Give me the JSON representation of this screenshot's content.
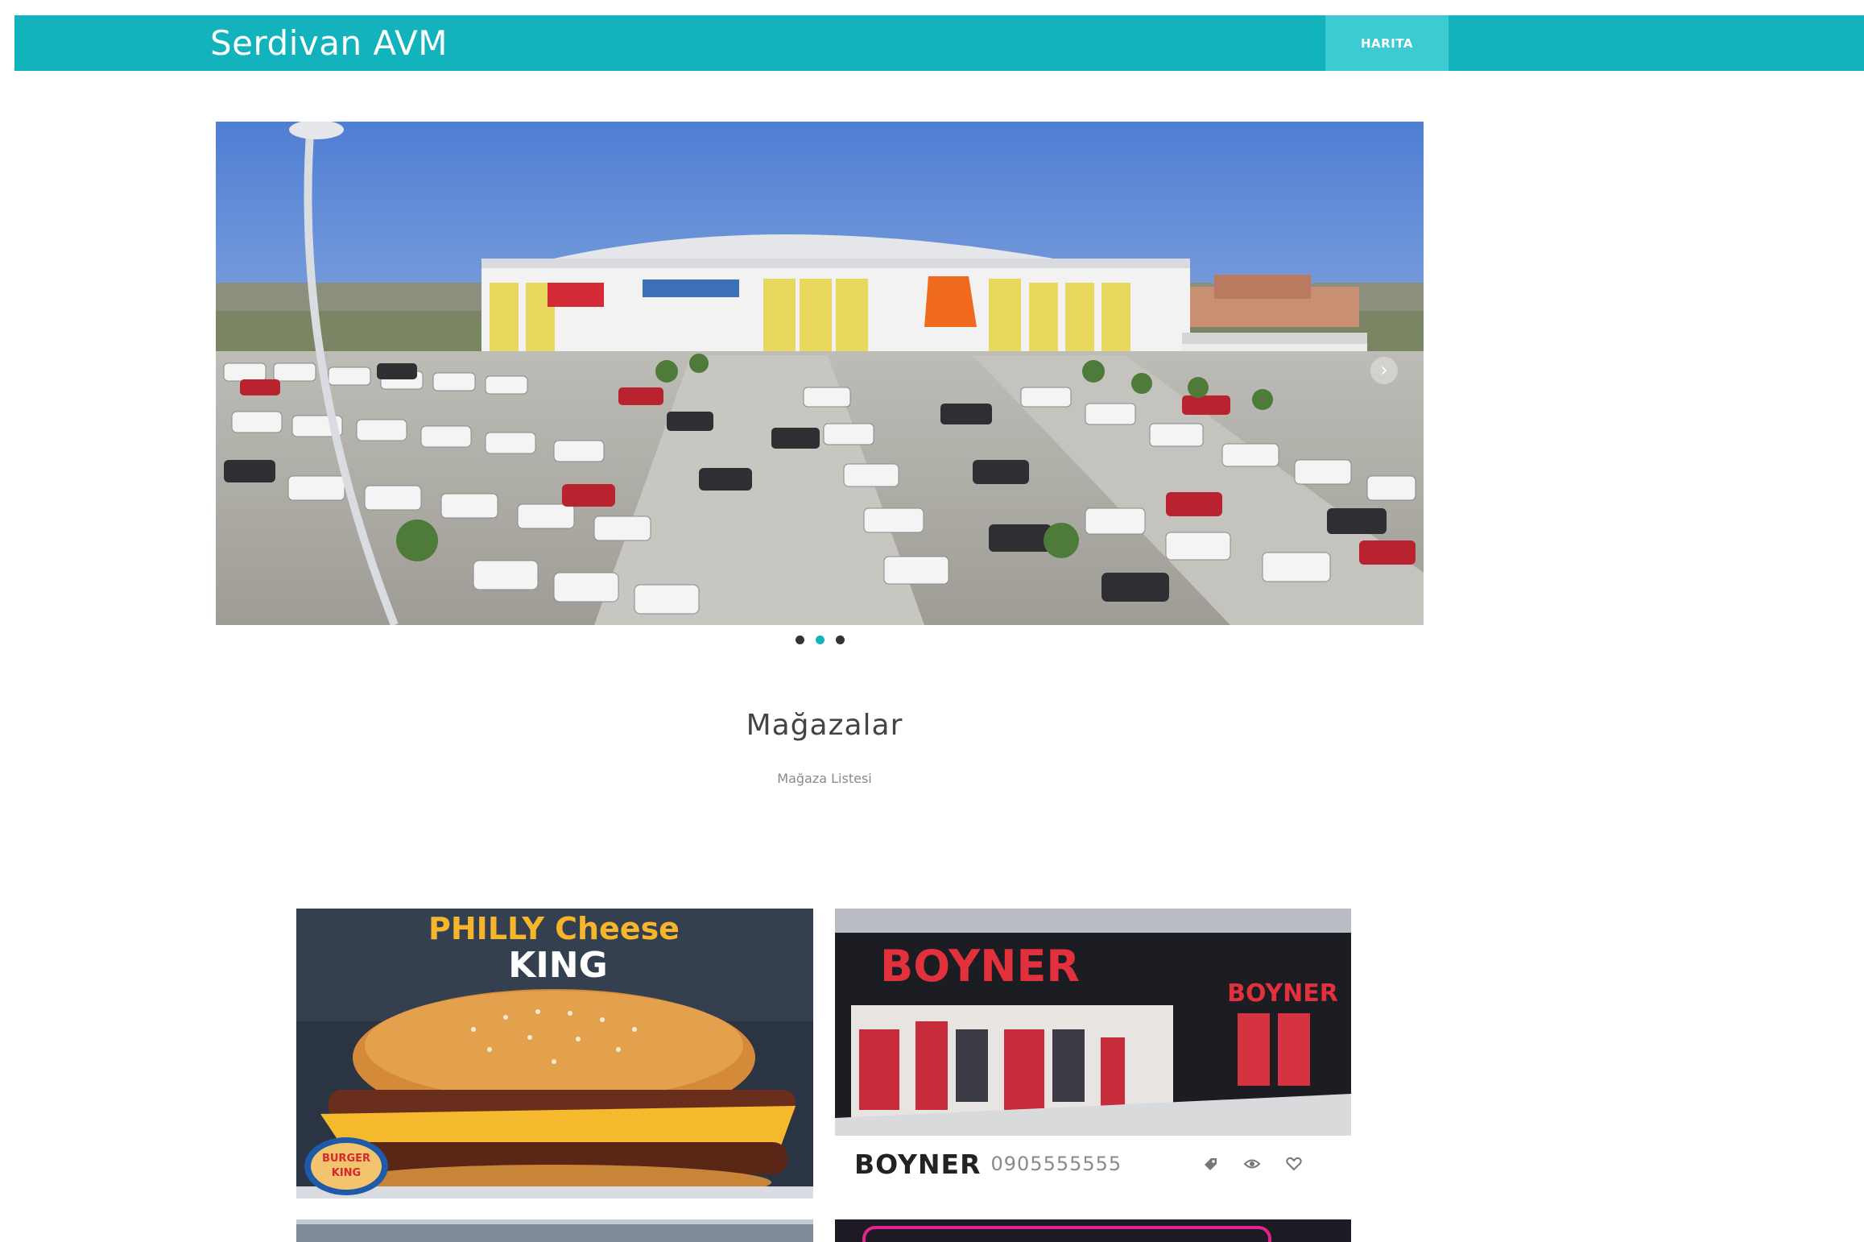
{
  "header": {
    "brand": "Serdivan AVM",
    "nav": [
      {
        "label": "HARITA"
      }
    ]
  },
  "carousel": {
    "slide_count": 3,
    "active_index": 1,
    "next_icon": "chevron-right-icon"
  },
  "section": {
    "title": "Mağazalar",
    "subtitle": "Mağaza Listesi"
  },
  "stores": [
    {
      "image_text": {
        "line1": "PHILLY Cheese",
        "line2": "KING",
        "logo": "BURGER KING"
      }
    },
    {
      "name": "BOYNER",
      "phone": "0905555555",
      "image_text": {
        "sign": "BOYNER",
        "sign2": "BOYNER"
      },
      "actions": [
        "tag-icon",
        "eye-icon",
        "heart-icon"
      ]
    }
  ],
  "colors": {
    "accent": "#12b3bd",
    "nav_active": "#3ccad3",
    "dot_inactive": "#333333"
  }
}
